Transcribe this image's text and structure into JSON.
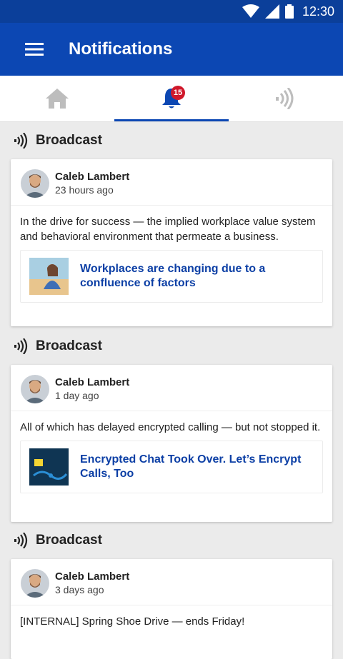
{
  "status_bar": {
    "time": "12:30"
  },
  "app_bar": {
    "title": "Notifications"
  },
  "tabs": [
    {
      "name": "home",
      "icon": "home-icon"
    },
    {
      "name": "notifications",
      "icon": "bell-icon",
      "badge": "15",
      "active": true
    },
    {
      "name": "broadcast",
      "icon": "broadcast-icon"
    }
  ],
  "feed": [
    {
      "section": "Broadcast",
      "author": "Caleb Lambert",
      "time": "23 hours ago",
      "text": "In the drive for success — the implied workplace value system and behavioral environment that permeate a business.",
      "link_title": "Workplaces are changing due to a confluence of factors"
    },
    {
      "section": "Broadcast",
      "author": "Caleb Lambert",
      "time": "1 day ago",
      "text": "All of which has delayed encrypted calling — but not stopped it.",
      "link_title": "Encrypted Chat Took Over. Let’s Encrypt Calls, Too"
    },
    {
      "section": "Broadcast",
      "author": "Caleb Lambert",
      "time": "3 days ago",
      "text": "[INTERNAL] Spring Shoe Drive — ends Friday!"
    }
  ],
  "colors": {
    "primary": "#0c47b3",
    "status_bar": "#0b3f9a",
    "badge": "#d0182b",
    "link": "#0c3fa5"
  }
}
